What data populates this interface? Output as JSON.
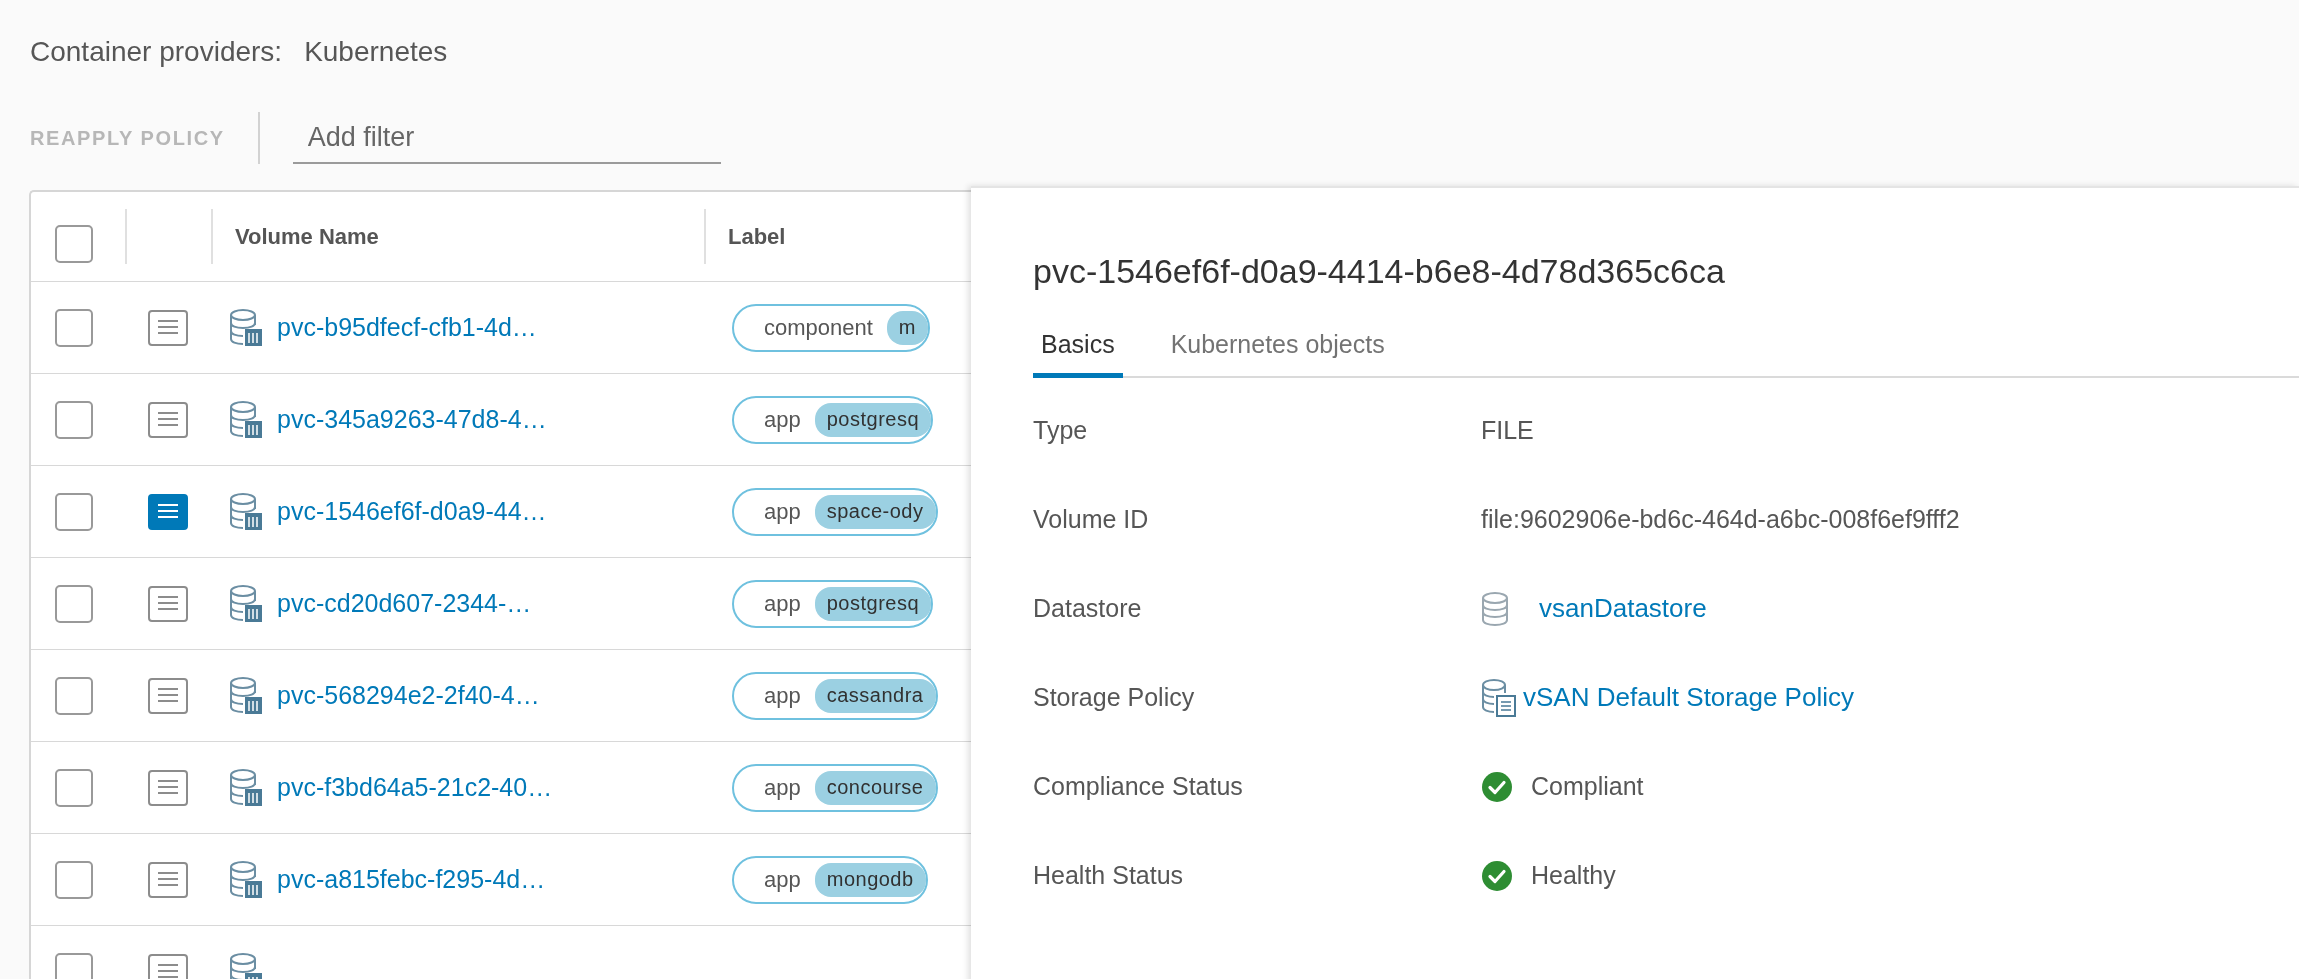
{
  "header": {
    "label": "Container providers:",
    "value": "Kubernetes"
  },
  "toolbar": {
    "action": "REAPPLY POLICY",
    "action_disabled": true,
    "filter": {
      "placeholder": "Add filter"
    }
  },
  "table": {
    "select_all": {
      "checked": false
    },
    "columns": [
      "Volume Name",
      "Label"
    ],
    "rows": [
      {
        "checked": false,
        "detail_open": false,
        "name": "pvc-b95dfecf-cfb1-4d…",
        "label": {
          "key": "component",
          "value": "m"
        }
      },
      {
        "checked": false,
        "detail_open": false,
        "name": "pvc-345a9263-47d8-4…",
        "label": {
          "key": "app",
          "value": "postgresq"
        }
      },
      {
        "checked": false,
        "detail_open": true,
        "name": "pvc-1546ef6f-d0a9-44…",
        "label": {
          "key": "app",
          "value": "space-ody"
        }
      },
      {
        "checked": false,
        "detail_open": false,
        "name": "pvc-cd20d607-2344-…",
        "label": {
          "key": "app",
          "value": "postgresq"
        }
      },
      {
        "checked": false,
        "detail_open": false,
        "name": "pvc-568294e2-2f40-4…",
        "label": {
          "key": "app",
          "value": "cassandra"
        }
      },
      {
        "checked": false,
        "detail_open": false,
        "name": "pvc-f3bd64a5-21c2-40…",
        "label": {
          "key": "app",
          "value": "concourse"
        }
      },
      {
        "checked": false,
        "detail_open": false,
        "name": "pvc-a815febc-f295-4d…",
        "label": {
          "key": "app",
          "value": "mongodb"
        }
      },
      {
        "checked": false,
        "detail_open": false
      }
    ]
  },
  "detail": {
    "title": "pvc-1546ef6f-d0a9-4414-b6e8-4d78d365c6ca",
    "tabs": [
      {
        "label": "Basics",
        "selected": true
      },
      {
        "label": "Kubernetes objects",
        "selected": false
      }
    ],
    "fields": [
      {
        "kind": "text",
        "label": "Type",
        "value": "FILE"
      },
      {
        "kind": "text",
        "label": "Volume ID",
        "value": "file:9602906e-bd6c-464d-a6bc-008f6ef9fff2"
      },
      {
        "kind": "datastore-link",
        "label": "Datastore",
        "value": "vsanDatastore"
      },
      {
        "kind": "policy-link",
        "label": "Storage Policy",
        "value": "vSAN Default Storage Policy"
      },
      {
        "kind": "status-ok",
        "label": "Compliance Status",
        "value": "Compliant"
      },
      {
        "kind": "status-ok",
        "label": "Health Status",
        "value": "Healthy"
      }
    ]
  }
}
